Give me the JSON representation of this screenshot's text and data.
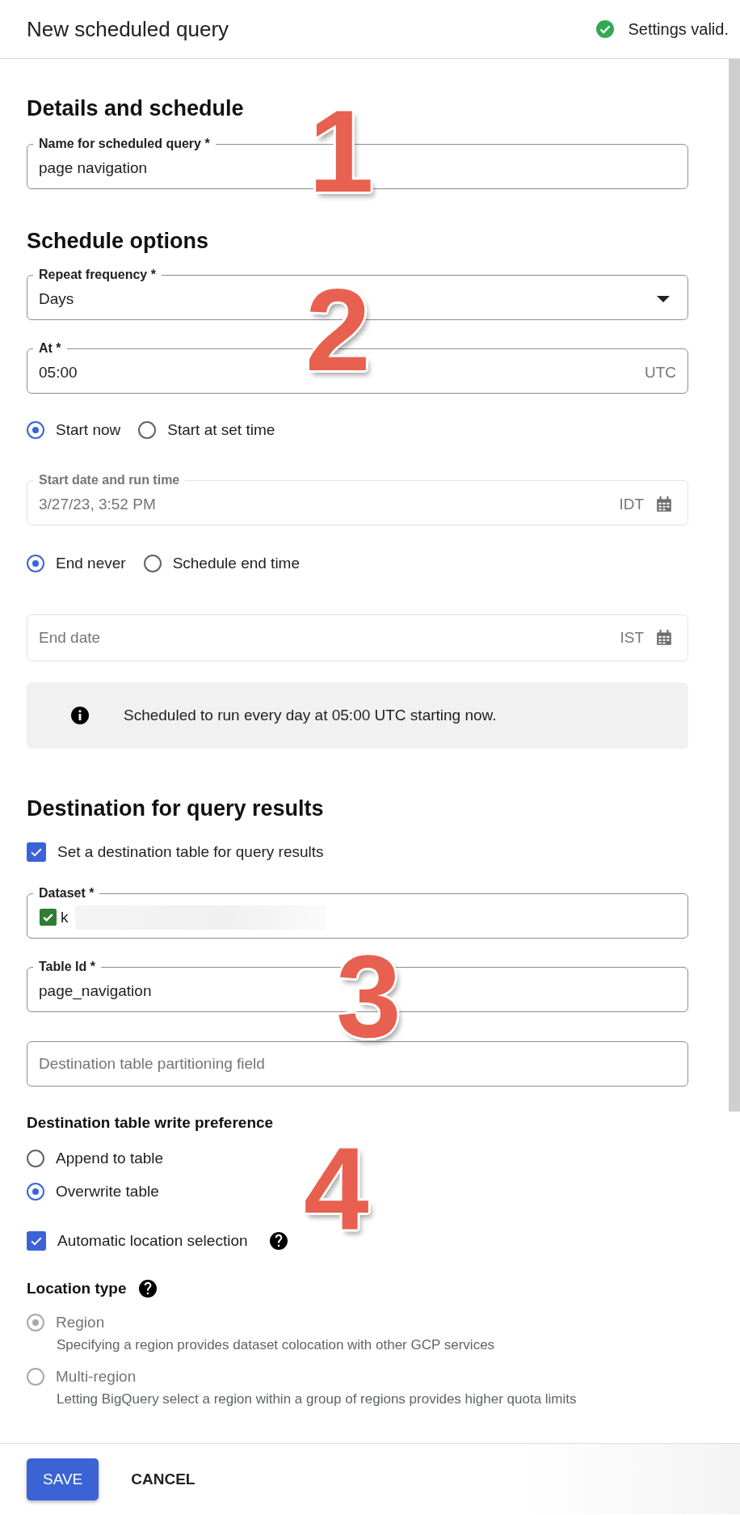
{
  "header": {
    "title": "New scheduled query",
    "status": "Settings valid."
  },
  "details": {
    "heading": "Details and schedule",
    "name_field": {
      "label": "Name for scheduled query *",
      "value": "page navigation"
    }
  },
  "schedule": {
    "heading": "Schedule options",
    "repeat_frequency": {
      "label": "Repeat frequency *",
      "value": "Days"
    },
    "at": {
      "label": "At *",
      "value": "05:00",
      "suffix": "UTC"
    },
    "start_options": [
      {
        "label": "Start now",
        "selected": true
      },
      {
        "label": "Start at set time",
        "selected": false
      }
    ],
    "start_date": {
      "label": "Start date and run time",
      "value": "3/27/23, 3:52 PM",
      "suffix": "IDT",
      "disabled": true
    },
    "end_options": [
      {
        "label": "End never",
        "selected": true
      },
      {
        "label": "Schedule end time",
        "selected": false
      }
    ],
    "end_date": {
      "placeholder": "End date",
      "suffix": "IST",
      "disabled": true
    },
    "info": "Scheduled to run every day at 05:00 UTC starting now."
  },
  "destination": {
    "heading": "Destination for query results",
    "set_destination": {
      "label": "Set a destination table for query results",
      "checked": true
    },
    "dataset": {
      "label": "Dataset *",
      "value": "k"
    },
    "table_id": {
      "label": "Table Id *",
      "value": "page_navigation"
    },
    "partitioning_field": {
      "placeholder": "Destination table partitioning field"
    },
    "write_preference": {
      "label": "Destination table write preference",
      "options": [
        {
          "label": "Append to table",
          "selected": false
        },
        {
          "label": "Overwrite table",
          "selected": true
        }
      ]
    },
    "automatic_location": {
      "label": "Automatic location selection",
      "checked": true
    },
    "location_type": {
      "label": "Location type",
      "options": [
        {
          "label": "Region",
          "description": "Specifying a region provides dataset colocation with other GCP services",
          "selected": true,
          "disabled": true
        },
        {
          "label": "Multi-region",
          "description": "Letting BigQuery select a region within a group of regions provides higher quota limits",
          "selected": false,
          "disabled": true
        }
      ]
    }
  },
  "footer": {
    "buttons": [
      {
        "label": "SAVE",
        "kind": "primary"
      },
      {
        "label": "CANCEL",
        "kind": "text"
      }
    ]
  },
  "callouts": [
    {
      "label": "1"
    },
    {
      "label": "2"
    },
    {
      "label": "3"
    },
    {
      "label": "4"
    }
  ]
}
